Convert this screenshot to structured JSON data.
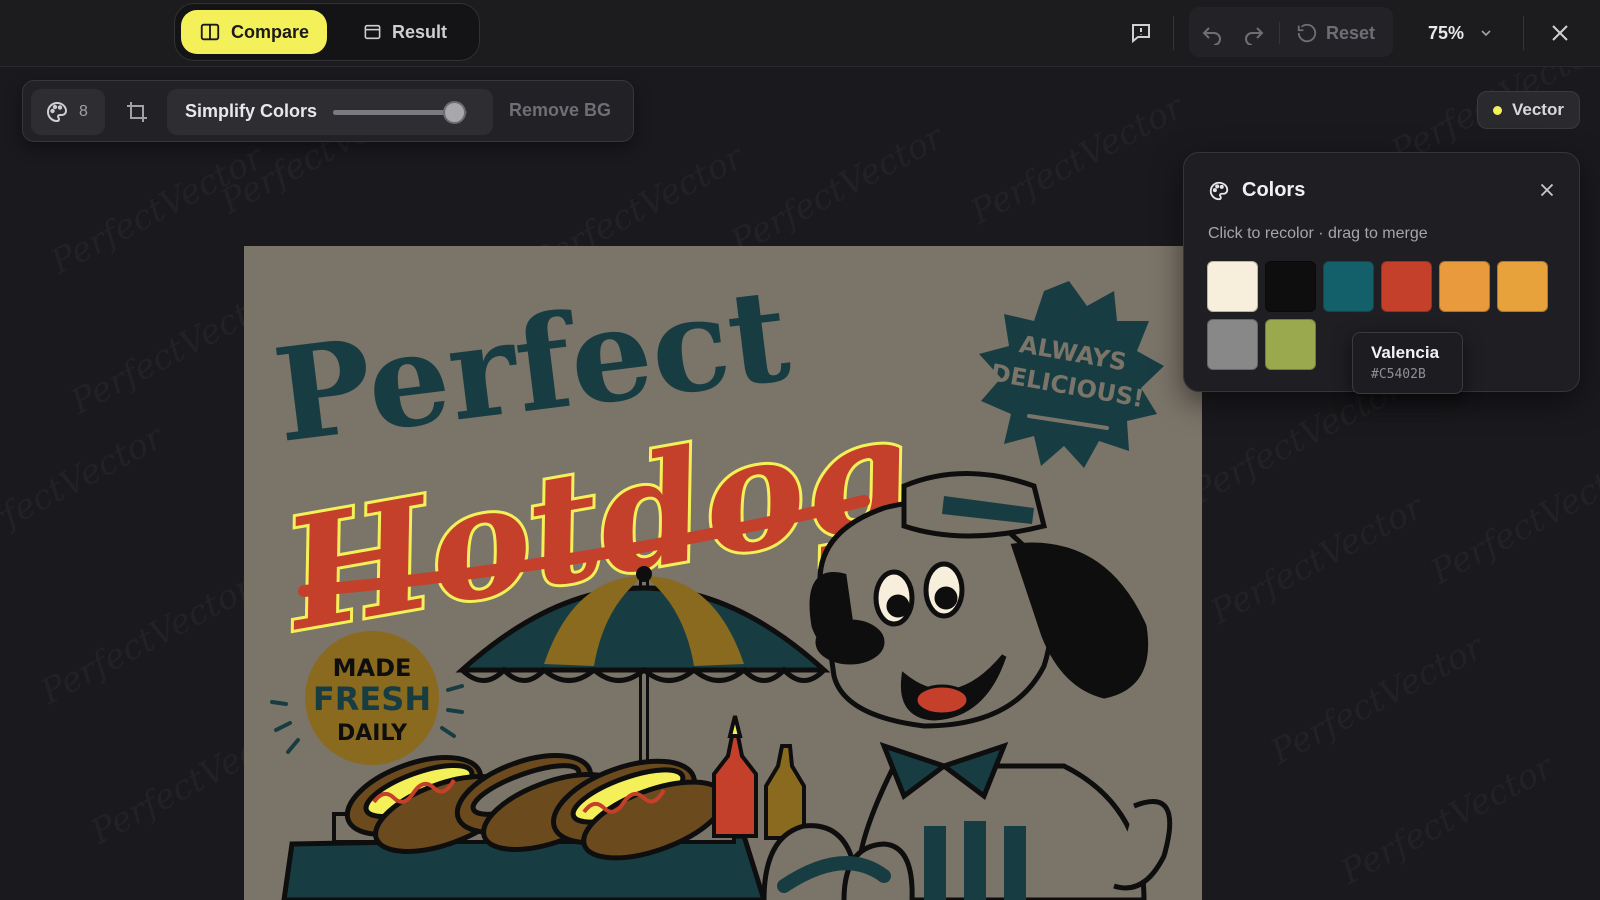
{
  "header": {
    "compare_label": "Compare",
    "result_label": "Result",
    "reset_label": "Reset",
    "zoom_value": "75%"
  },
  "toolbar": {
    "color_count": "8",
    "simplify_label": "Simplify Colors",
    "simplify_level": 0.9,
    "remove_bg_label": "Remove BG"
  },
  "mode_badge": {
    "label": "Vector",
    "dot_color": "#F4F05A"
  },
  "colors_panel": {
    "title": "Colors",
    "hint": "Click to recolor · drag to merge",
    "swatches": [
      "#F7EEDC",
      "#0E0E0E",
      "#14606A",
      "#C5402B",
      "#E89A3C",
      "#E8A23C",
      "#888888",
      "#9AA84E"
    ],
    "tooltip": {
      "name": "Valencia",
      "hex": "#C5402B"
    }
  },
  "artwork": {
    "title_line1": "Perfect",
    "title_line2": "Hotdog",
    "badge_line1": "ALWAYS",
    "badge_line2": "DELICIOUS!",
    "seal_line1": "MADE",
    "seal_line2": "FRESH",
    "seal_line3": "DAILY"
  },
  "watermark": "PerfectVector",
  "icons": [
    "compare-icon",
    "result-icon",
    "feedback-icon",
    "undo-icon",
    "redo-icon",
    "reset-icon",
    "chevron-down-icon",
    "close-icon",
    "palette-icon",
    "crop-icon"
  ]
}
